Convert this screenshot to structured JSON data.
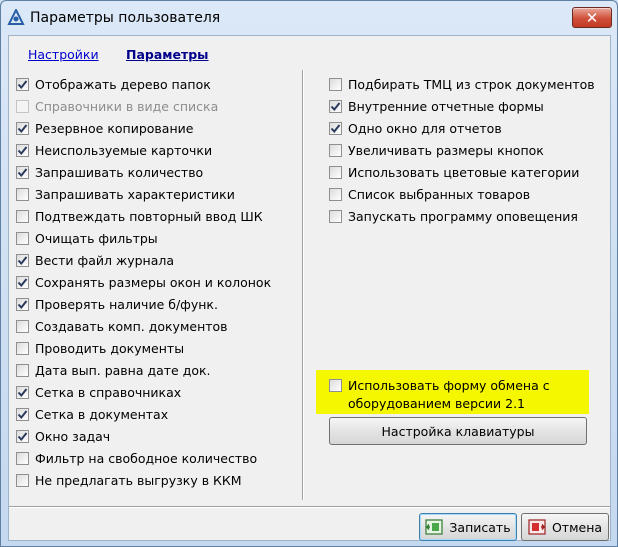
{
  "window": {
    "title": "Параметры пользователя"
  },
  "tabs": [
    {
      "label": "Настройки",
      "active": false
    },
    {
      "label": "Параметры",
      "active": true
    }
  ],
  "left_options": [
    {
      "label": "Отображать дерево папок",
      "checked": true,
      "disabled": false
    },
    {
      "label": "Справочники в виде списка",
      "checked": false,
      "disabled": true
    },
    {
      "label": "Резервное копирование",
      "checked": true,
      "disabled": false
    },
    {
      "label": "Неиспользуемые карточки",
      "checked": true,
      "disabled": false
    },
    {
      "label": "Запрашивать количество",
      "checked": true,
      "disabled": false
    },
    {
      "label": "Запрашивать характеристики",
      "checked": false,
      "disabled": false
    },
    {
      "label": "Подтвеждать повторный ввод ШК",
      "checked": false,
      "disabled": false
    },
    {
      "label": "Очищать фильтры",
      "checked": false,
      "disabled": false
    },
    {
      "label": "Вести файл журнала",
      "checked": true,
      "disabled": false
    },
    {
      "label": "Сохранять размеры окон и колонок",
      "checked": true,
      "disabled": false
    },
    {
      "label": "Проверять наличие б/функ.",
      "checked": true,
      "disabled": false
    },
    {
      "label": "Создавать комп. документов",
      "checked": false,
      "disabled": false
    },
    {
      "label": "Проводить документы",
      "checked": false,
      "disabled": false
    },
    {
      "label": "Дата вып. равна дате док.",
      "checked": false,
      "disabled": false
    },
    {
      "label": "Сетка в справочниках",
      "checked": true,
      "disabled": false
    },
    {
      "label": "Сетка в документах",
      "checked": true,
      "disabled": false
    },
    {
      "label": "Окно задач",
      "checked": true,
      "disabled": false
    },
    {
      "label": "Фильтр на свободное количество",
      "checked": false,
      "disabled": false
    },
    {
      "label": "Не предлагать выгрузку в ККМ",
      "checked": false,
      "disabled": false
    }
  ],
  "right_options": [
    {
      "label": "Подбирать ТМЦ из строк документов",
      "checked": false,
      "disabled": false
    },
    {
      "label": "Внутренние отчетные формы",
      "checked": true,
      "disabled": false
    },
    {
      "label": "Одно окно для отчетов",
      "checked": true,
      "disabled": false
    },
    {
      "label": "Увеличивать размеры кнопок",
      "checked": false,
      "disabled": false
    },
    {
      "label": "Использовать цветовые категории",
      "checked": false,
      "disabled": false
    },
    {
      "label": "Список выбранных товаров",
      "checked": false,
      "disabled": false
    },
    {
      "label": "Запускать программу оповещения",
      "checked": false,
      "disabled": false
    }
  ],
  "exchange_option": {
    "line1": "Использовать форму обмена с",
    "line2": "оборудованием версии 2.1",
    "checked": false,
    "highlight_color": "#f5f700"
  },
  "keyboard_button": {
    "label": "Настройка клавиатуры"
  },
  "footer": {
    "save_label": "Записать",
    "cancel_label": "Отмена",
    "save_icon": "save-icon",
    "cancel_icon": "cancel-icon"
  },
  "colors": {
    "accent": "#00008b",
    "link": "#0000cc",
    "close": "#c23a24"
  }
}
